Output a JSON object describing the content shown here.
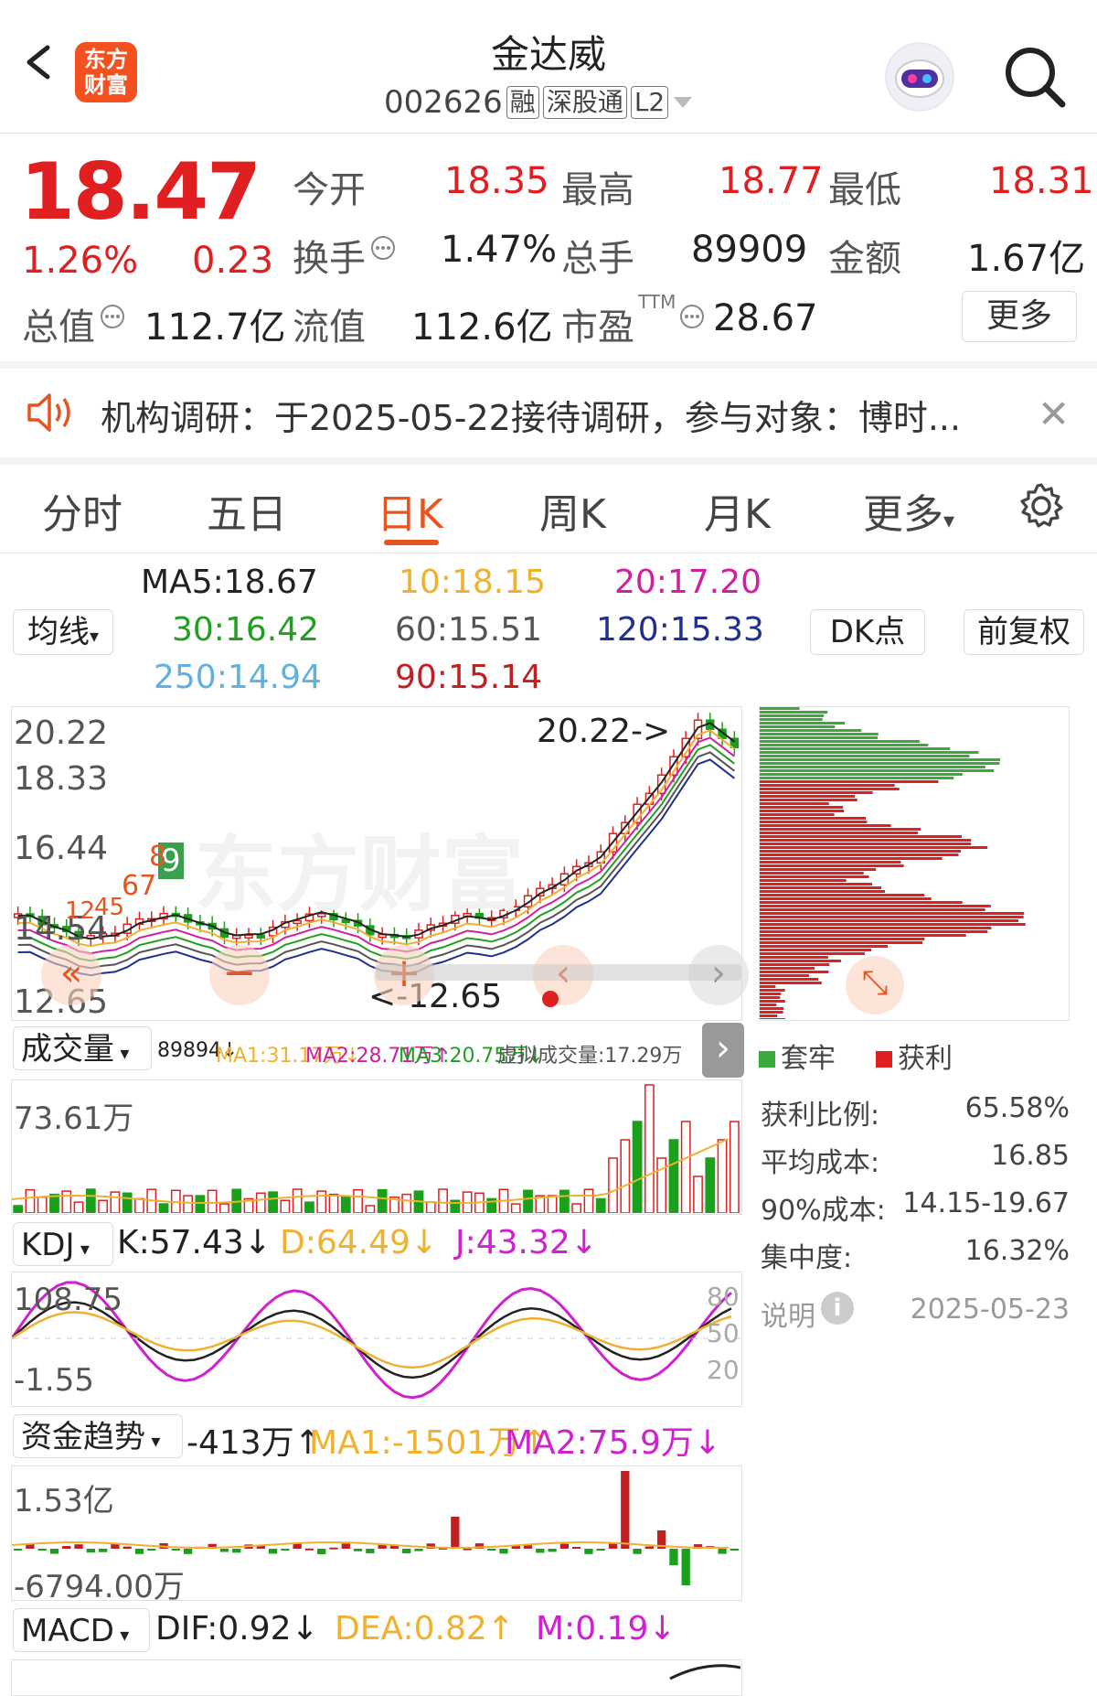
{
  "header": {
    "logo_text_1": "东方",
    "logo_text_2": "财富",
    "title": "金达威",
    "code": "002626",
    "tags": [
      "融",
      "深股通",
      "L2"
    ]
  },
  "quote": {
    "price": "18.47",
    "change_pct": "1.26%",
    "change": "0.23",
    "open_label": "今开",
    "open": "18.35",
    "high_label": "最高",
    "high": "18.77",
    "low_label": "最低",
    "low": "18.31",
    "turnover_label": "换手",
    "turnover": "1.47%",
    "volume_label": "总手",
    "volume": "89909",
    "amount_label": "金额",
    "amount": "1.67亿",
    "mktcap_label": "总值",
    "mktcap": "112.7亿",
    "float_label": "流值",
    "float": "112.6亿",
    "pe_label": "市盈",
    "pe_sup": "TTM",
    "pe": "28.67",
    "more": "更多"
  },
  "notice": {
    "text": "机构调研：于2025-05-22接待调研，参与对象：博时..."
  },
  "tabs": [
    "分时",
    "五日",
    "日K",
    "周K",
    "月K",
    "更多"
  ],
  "active_tab": "日K",
  "ma": {
    "selector": "均线",
    "ma5": "MA5:18.67",
    "ma10": "10:18.15",
    "ma20": "20:17.20",
    "ma30": "30:16.42",
    "ma60": "60:15.51",
    "ma120": "120:15.33",
    "ma250": "250:14.94",
    "ma90": "90:15.14",
    "dk": "DK点",
    "fq": "前复权",
    "colors": {
      "ma5": "#222222",
      "ma10": "#f0b030",
      "ma20": "#d020a0",
      "ma30": "#20a020",
      "ma60": "#555555",
      "ma120": "#203090",
      "ma250": "#60b0e0",
      "ma90": "#c02020"
    }
  },
  "kchart": {
    "y_labels": [
      "20.22",
      "18.33",
      "16.44",
      "14.54",
      "12.65"
    ],
    "max_marker": "20.22->",
    "min_marker": "<-12.65",
    "signal_labels": [
      "8",
      "9",
      "67",
      "12",
      "45"
    ],
    "watermark": "东方财富"
  },
  "chip": {
    "legend_trap": "套牢",
    "legend_profit": "获利",
    "profit_ratio_label": "获利比例:",
    "profit_ratio": "65.58%",
    "avg_cost_label": "平均成本:",
    "avg_cost": "16.85",
    "cost90_label": "90%成本:",
    "cost90": "14.15-19.67",
    "concentration_label": "集中度:",
    "concentration": "16.32%",
    "note_label": "说明",
    "date": "2025-05-23"
  },
  "volume": {
    "selector": "成交量",
    "line": "89894↓",
    "ma1": "MA1:31.17万↓",
    "ma2": "MA2:28.71万↑",
    "ma3": "MA3:20.75万↓",
    "virtual": "虚拟成交量:17.29万",
    "max_label": "73.61万"
  },
  "kdj": {
    "selector": "KDJ",
    "k": "K:57.43↓",
    "d": "D:64.49↓",
    "j": "J:43.32↓",
    "max_label": "108.75",
    "min_label": "-1.55",
    "ref_80": "80",
    "ref_50": "50",
    "ref_20": "20"
  },
  "fund": {
    "selector": "资金趋势",
    "value": "-413万↑",
    "ma1": "MA1:-1501万↑",
    "ma2": "MA2:75.9万↓",
    "max_label": "1.53亿",
    "min_label": "-6794.00万"
  },
  "macd": {
    "selector": "MACD",
    "dif": "DIF:0.92↓",
    "dea": "DEA:0.82↑",
    "m": "M:0.19↓"
  }
}
